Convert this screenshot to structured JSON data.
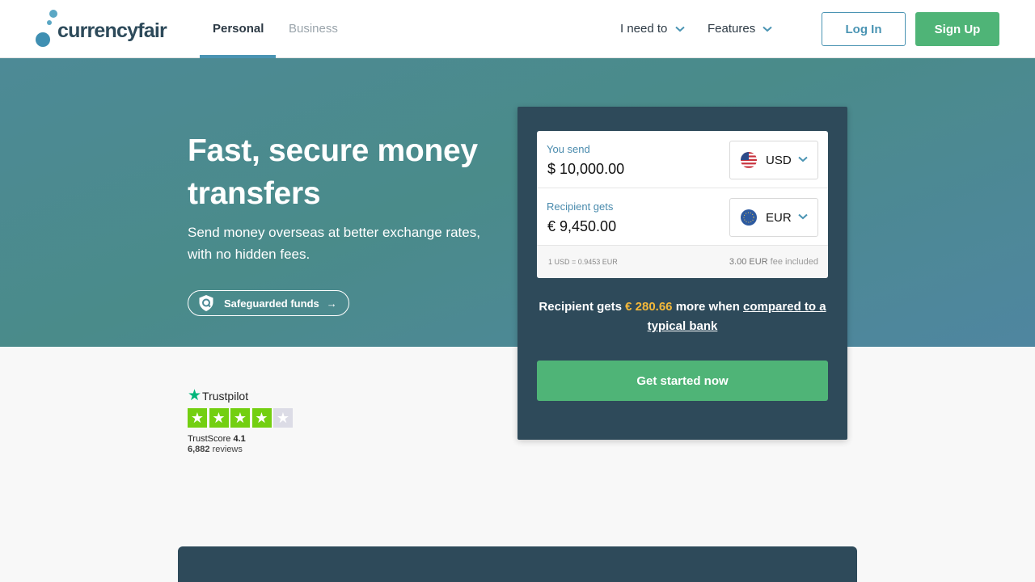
{
  "header": {
    "brand": "currencyfair",
    "tabs": [
      {
        "label": "Personal",
        "active": true
      },
      {
        "label": "Business",
        "active": false
      }
    ],
    "menus": [
      {
        "label": "I need to",
        "icon": "chevron-down-icon"
      },
      {
        "label": "Features",
        "icon": "chevron-down-icon"
      }
    ],
    "login_label": "Log In",
    "signup_label": "Sign Up"
  },
  "hero": {
    "title": "Fast, secure money transfers",
    "subtitle": "Send money overseas at better exchange rates, with no hidden fees.",
    "safeguard_label": "Safeguarded funds",
    "safeguard_icon": "shield-search-icon",
    "safeguard_arrow": "→"
  },
  "trustpilot": {
    "name": "Trustpilot",
    "score_label": "TrustScore",
    "score": "4.1",
    "reviews_count": "6,882",
    "reviews_label": "reviews",
    "stars_filled": 4,
    "stars_total": 5,
    "colors": {
      "filled": "#73cf11",
      "empty": "#dcdce6",
      "logo_star": "#00b67a"
    }
  },
  "converter": {
    "send": {
      "label": "You send",
      "amount": "$ 10,000.00",
      "currency": "USD",
      "flag": "us-flag-icon"
    },
    "receive": {
      "label": "Recipient gets",
      "amount": "€ 9,450.00",
      "currency": "EUR",
      "flag": "eu-flag-icon"
    },
    "rate": "1 USD = 0.9453 EUR",
    "fee_amount": "3.00 EUR",
    "fee_text": "fee included",
    "savings": {
      "prefix": "Recipient gets",
      "amount": "€ 280.66",
      "middle": "more when",
      "link": "compared to a typical bank"
    },
    "cta_label": "Get started now"
  },
  "colors": {
    "accent_green": "#4fb477",
    "accent_blue": "#4a94b3",
    "panel_dark": "#2e4a5a",
    "highlight_amount": "#f5b93a"
  }
}
